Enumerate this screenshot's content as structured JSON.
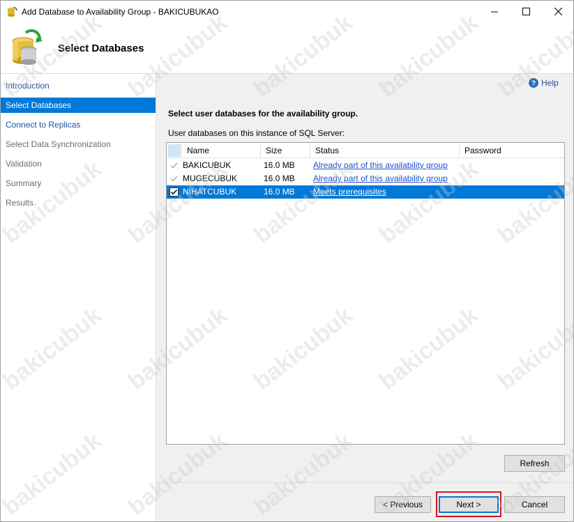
{
  "window": {
    "title": "Add Database to Availability Group - BAKICUBUKAO"
  },
  "header": {
    "title": "Select Databases"
  },
  "sidebar": {
    "items": [
      {
        "label": "Introduction",
        "state": "link"
      },
      {
        "label": "Select Databases",
        "state": "active"
      },
      {
        "label": "Connect to Replicas",
        "state": "link"
      },
      {
        "label": "Select Data Synchronization",
        "state": "disabled"
      },
      {
        "label": "Validation",
        "state": "disabled"
      },
      {
        "label": "Summary",
        "state": "disabled"
      },
      {
        "label": "Results",
        "state": "disabled"
      }
    ]
  },
  "help_label": "Help",
  "main": {
    "instruction": "Select user databases for the availability group.",
    "grid_caption": "User databases on this instance of SQL Server:"
  },
  "grid": {
    "columns": [
      "Name",
      "Size",
      "Status",
      "Password"
    ],
    "rows": [
      {
        "name": "BAKICUBUK",
        "size": "16.0 MB",
        "status": "Already part of this availability group",
        "checked": true,
        "enabled": false,
        "selected": false
      },
      {
        "name": "MUGECUBUK",
        "size": "16.0 MB",
        "status": "Already part of this availability group",
        "checked": true,
        "enabled": false,
        "selected": false
      },
      {
        "name": "NIHATCUBUK",
        "size": "16.0 MB",
        "status": "Meets prerequisites",
        "checked": true,
        "enabled": true,
        "selected": true
      }
    ]
  },
  "buttons": {
    "refresh": "Refresh",
    "previous": "< Previous",
    "next": "Next >",
    "cancel": "Cancel"
  },
  "watermark": "bakicubuk",
  "colors": {
    "accent": "#0078d7",
    "link": "#1f4f9e",
    "highlight": "#d2141e"
  }
}
